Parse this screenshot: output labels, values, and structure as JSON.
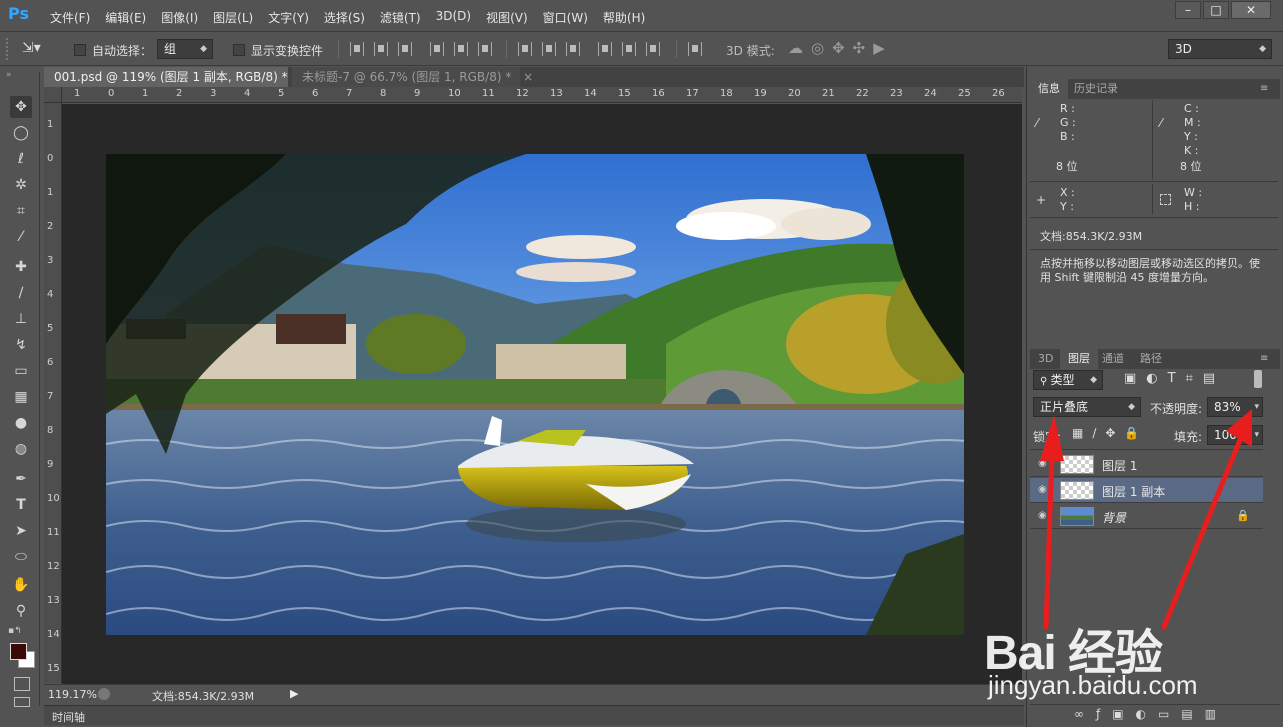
{
  "app": {
    "logo": "Ps"
  },
  "menu": [
    "文件(F)",
    "编辑(E)",
    "图像(I)",
    "图层(L)",
    "文字(Y)",
    "选择(S)",
    "滤镜(T)",
    "3D(D)",
    "视图(V)",
    "窗口(W)",
    "帮助(H)"
  ],
  "window": {
    "minimize": "–",
    "maximize": "□",
    "close": "✕"
  },
  "options": {
    "auto_select_label": "自动选择：",
    "auto_select_value": "组",
    "show_transform_label": "显示变换控件",
    "mode_3d_label": "3D 模式:",
    "workspace": "3D"
  },
  "tabs": [
    {
      "label": "001.psd @ 119% (图层 1 副本, RGB/8) *",
      "close": "×"
    },
    {
      "label": "未标题-7 @ 66.7% (图层 1, RGB/8) *",
      "close": "×"
    }
  ],
  "ruler": {
    "h": [
      "1",
      "0",
      "1",
      "2",
      "3",
      "4",
      "5",
      "6",
      "7",
      "8",
      "9",
      "10",
      "11",
      "12",
      "13",
      "14",
      "15",
      "16",
      "17",
      "18",
      "19",
      "20",
      "21",
      "22",
      "23",
      "24",
      "25",
      "26"
    ],
    "v": [
      "1",
      "0",
      "1",
      "2",
      "3",
      "4",
      "5",
      "6",
      "7",
      "8",
      "9",
      "10",
      "11",
      "12",
      "13",
      "14",
      "15",
      "16"
    ]
  },
  "status": {
    "zoom": "119.17%",
    "doc": "文档:854.3K/2.93M"
  },
  "timeline": {
    "label": "时间轴"
  },
  "info_panel": {
    "tabs": [
      "信息",
      "历史记录"
    ],
    "rgb": [
      "R :",
      "G :",
      "B :"
    ],
    "cmyk": [
      "C :",
      "M :",
      "Y :",
      "K :"
    ],
    "bits_left": "8 位",
    "bits_right": "8 位",
    "xy": [
      "X :",
      "Y :"
    ],
    "wh": [
      "W :",
      "H :"
    ],
    "doc": "文档:854.3K/2.93M",
    "hint": "点按并拖移以移动图层或移动选区的拷贝。使用 Shift 键限制沿 45 度增量方向。"
  },
  "layers_panel": {
    "tabs": [
      "3D",
      "图层",
      "通道",
      "路径"
    ],
    "filter_kind": "类型",
    "blend_mode": "正片叠底",
    "opacity_label": "不透明度:",
    "opacity_value": "83%",
    "lock_label": "锁定:",
    "fill_label": "填充:",
    "fill_value": "100%",
    "layers": [
      {
        "name": "图层 1",
        "selected": false
      },
      {
        "name": "图层 1 副本",
        "selected": true
      },
      {
        "name": "背景",
        "selected": false,
        "locked": true
      }
    ]
  },
  "watermark": {
    "brand": "Bai 经验",
    "url": "jingyan.baidu.com"
  },
  "colors": {
    "fg": "#3b0a05",
    "bg": "#ffffff",
    "annotation": "#e81e1e",
    "ps_blue": "#31a8ff"
  }
}
